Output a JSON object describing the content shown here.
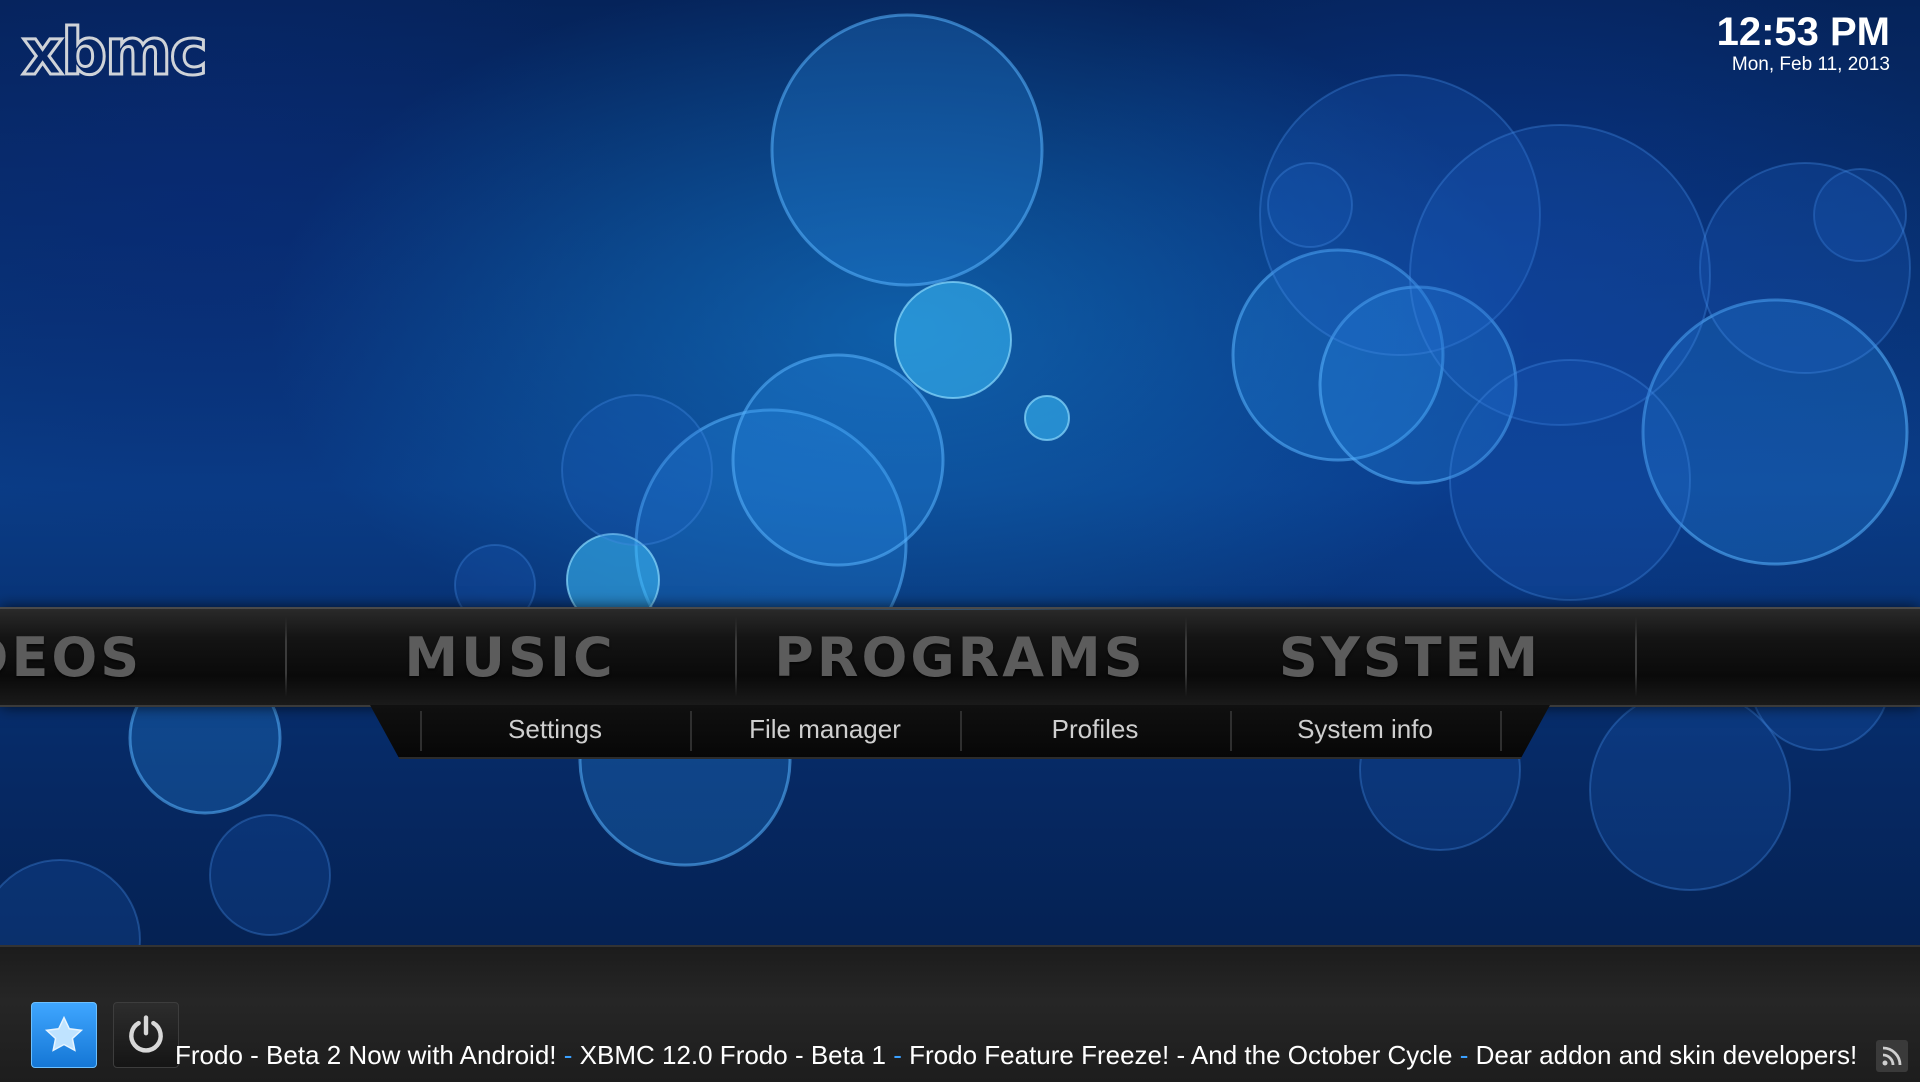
{
  "header": {
    "logo_text": "xbmc",
    "time": "12:53 PM",
    "date": "Mon, Feb 11, 2013"
  },
  "main_menu": {
    "items": [
      {
        "label": "VIDEOS"
      },
      {
        "label": "MUSIC"
      },
      {
        "label": "PROGRAMS"
      },
      {
        "label": "SYSTEM"
      }
    ],
    "selected": "SYSTEM"
  },
  "submenu": {
    "items": [
      {
        "label": "Settings"
      },
      {
        "label": "File manager"
      },
      {
        "label": "Profiles"
      },
      {
        "label": "System info"
      }
    ]
  },
  "bottom_bar": {
    "favourites_icon": "star-icon",
    "power_icon": "power-icon",
    "rss_icon": "rss-icon",
    "ticker": [
      {
        "text": "Frodo - Beta 2 Now with Android!",
        "sep": " - "
      },
      {
        "text": "XBMC 12.0 Frodo - Beta 1",
        "sep": " - "
      },
      {
        "text": "Frodo Feature Freeze! - And the October Cycle",
        "sep": " - "
      },
      {
        "text": "Dear addon and skin developers!",
        "sep": ""
      }
    ]
  },
  "colors": {
    "accent": "#3aa0ff",
    "favourites_button": "#1577d6",
    "menu_text": "#5c5c5c"
  }
}
